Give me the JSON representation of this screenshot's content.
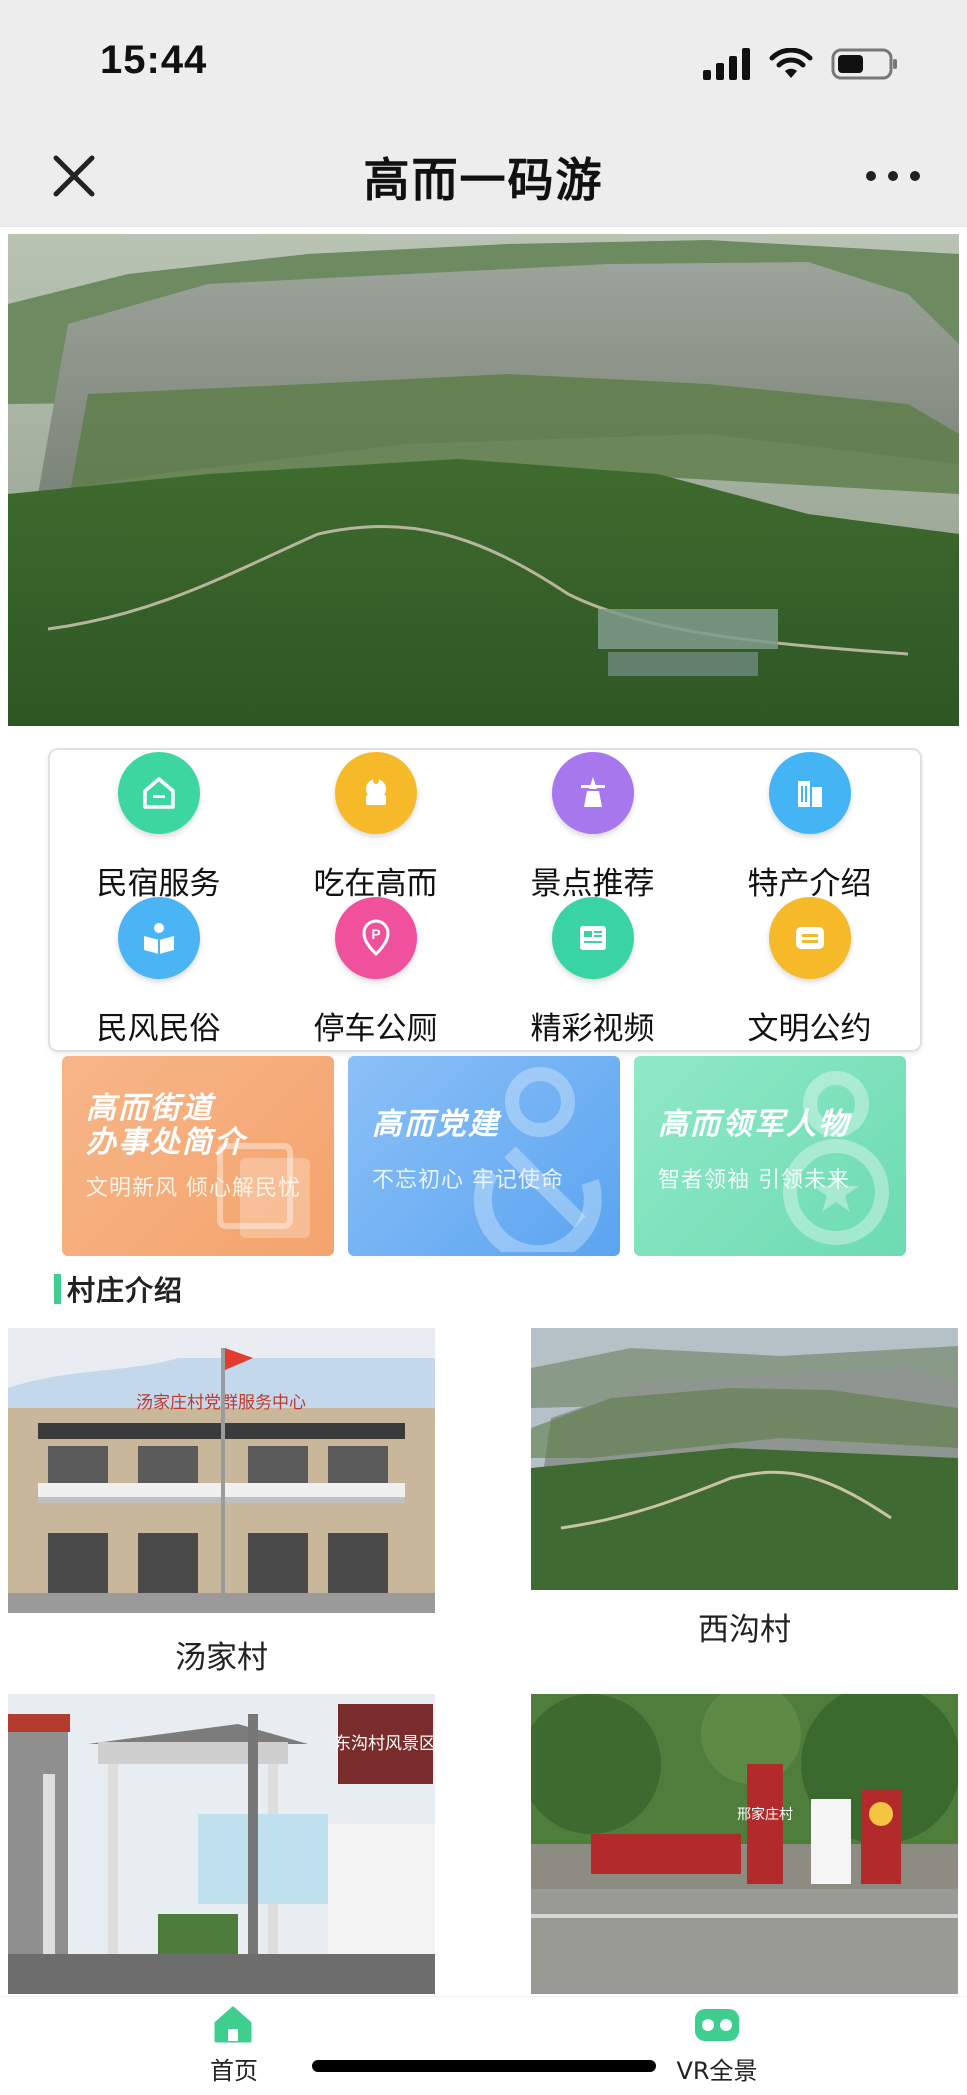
{
  "status": {
    "time": "15:44"
  },
  "nav": {
    "title": "高而一码游"
  },
  "menu": [
    {
      "label": "民宿服务",
      "icon": "home-icon",
      "color": "#3dd6a0"
    },
    {
      "label": "吃在高而",
      "icon": "cake-icon",
      "color": "#f5b92a"
    },
    {
      "label": "景点推荐",
      "icon": "tower-icon",
      "color": "#a777ee"
    },
    {
      "label": "特产介绍",
      "icon": "building-icon",
      "color": "#45b4f5"
    },
    {
      "label": "民风民俗",
      "icon": "book-icon",
      "color": "#4bb4f5"
    },
    {
      "label": "停车公厕",
      "icon": "parking-icon",
      "color": "#f0519c"
    },
    {
      "label": "精彩视频",
      "icon": "news-icon",
      "color": "#39d3a5"
    },
    {
      "label": "文明公约",
      "icon": "message-icon",
      "color": "#f5b92a"
    }
  ],
  "promos": [
    {
      "title_line1": "高而街道",
      "title_line2": "办事处简介",
      "subtitle": "文明新风 倾心解民忧"
    },
    {
      "title_line1": "高而党建",
      "title_line2": "",
      "subtitle": "不忘初心 牢记使命"
    },
    {
      "title_line1": "高而领军人物",
      "title_line2": "",
      "subtitle": "智者领袖 引领未来"
    }
  ],
  "section": {
    "title": "村庄介绍"
  },
  "villages": [
    {
      "name": "汤家村",
      "sign": "汤家庄村党群服务中心"
    },
    {
      "name": "西沟村"
    },
    {
      "name": "",
      "sign": "东沟村风景区"
    },
    {
      "name": "",
      "sign": "邢家庄村"
    }
  ],
  "tabs": [
    {
      "label": "首页",
      "icon": "home-tab-icon",
      "color": "#3ecf8e"
    },
    {
      "label": "VR全景",
      "icon": "vr-glasses-icon",
      "color": "#3ecf8e"
    }
  ]
}
